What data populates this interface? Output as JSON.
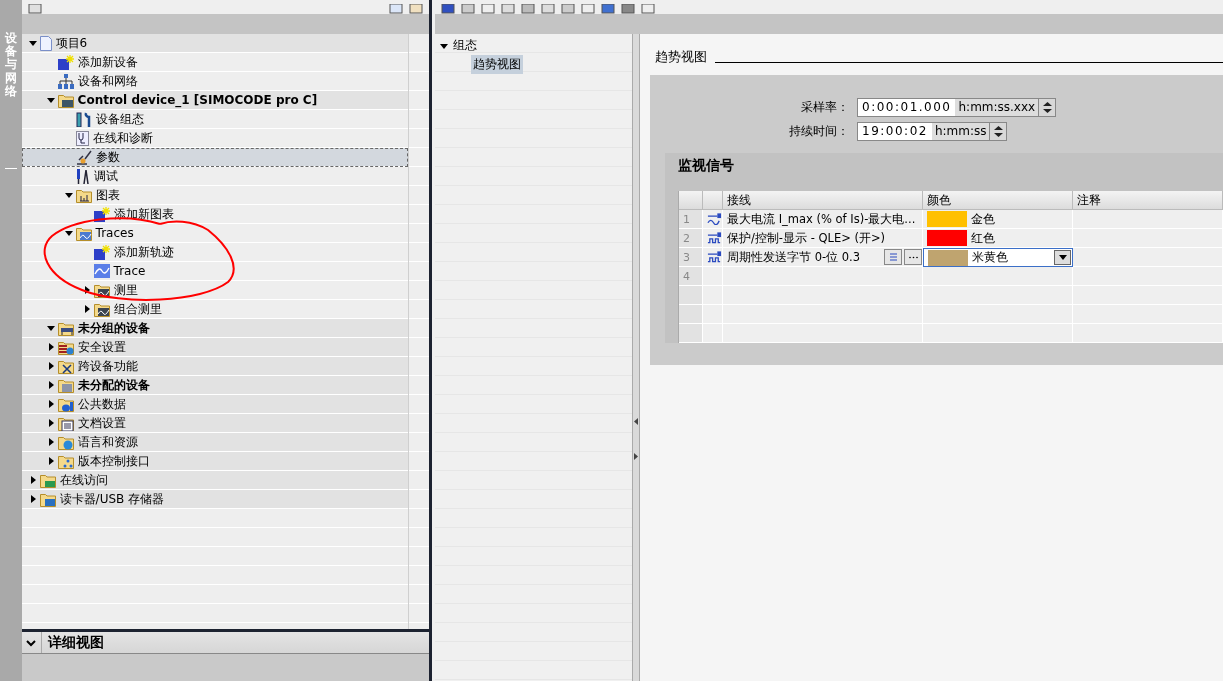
{
  "side_tab": {
    "label": "设备与网络"
  },
  "project_tree": {
    "items": [
      {
        "label": "项目6",
        "kind": "project",
        "expanded": true,
        "selected": false,
        "children": [
          {
            "label": "添加新设备",
            "kind": "add",
            "selected": false
          },
          {
            "label": "设备和网络",
            "kind": "network",
            "selected": false
          },
          {
            "label": "Control device_1 [SIMOCODE pro C]",
            "kind": "device",
            "bold": true,
            "expanded": true,
            "selected": false,
            "children": [
              {
                "label": "设备组态",
                "kind": "config",
                "selected": false
              },
              {
                "label": "在线和诊断",
                "kind": "diagnostics",
                "selected": false
              },
              {
                "label": "参数",
                "kind": "parameters",
                "selected": true
              },
              {
                "label": "调试",
                "kind": "tools",
                "selected": false
              },
              {
                "label": "图表",
                "kind": "chartfolder",
                "expanded": true,
                "selected": false,
                "children": [
                  {
                    "label": "添加新图表",
                    "kind": "add",
                    "selected": false
                  }
                ]
              },
              {
                "label": "Traces",
                "kind": "tracefolder",
                "expanded": true,
                "selected": false,
                "children": [
                  {
                    "label": "添加新轨迹",
                    "kind": "add",
                    "selected": false
                  },
                  {
                    "label": "Trace",
                    "kind": "trace",
                    "selected": false
                  },
                  {
                    "label": "测里",
                    "kind": "measurefolder",
                    "expanded": false,
                    "selected": false
                  },
                  {
                    "label": "组合测里",
                    "kind": "measurefolder",
                    "expanded": false,
                    "selected": false
                  }
                ]
              }
            ]
          },
          {
            "label": "未分组的设备",
            "kind": "groupfolder",
            "bold": true,
            "expanded": true,
            "selected": false
          },
          {
            "label": "安全设置",
            "kind": "securityfolder",
            "expanded": false,
            "selected": false
          },
          {
            "label": "跨设备功能",
            "kind": "crossfolder",
            "expanded": false,
            "selected": false
          },
          {
            "label": "未分配的设备",
            "kind": "unknownfolder",
            "bold": true,
            "expanded": false,
            "selected": false
          },
          {
            "label": "公共数据",
            "kind": "datafolder",
            "expanded": false,
            "selected": false
          },
          {
            "label": "文档设置",
            "kind": "docfolder",
            "expanded": false,
            "selected": false
          },
          {
            "label": "语言和资源",
            "kind": "globefolder",
            "expanded": false,
            "selected": false
          },
          {
            "label": "版本控制接口",
            "kind": "versionfolder",
            "expanded": false,
            "selected": false
          }
        ]
      },
      {
        "label": "在线访问",
        "kind": "onlinefolder",
        "expanded": false,
        "selected": false
      },
      {
        "label": "读卡器/USB 存储器",
        "kind": "cardfolder",
        "expanded": false,
        "selected": false
      }
    ]
  },
  "details_view": {
    "title": "详细视图",
    "expanded": true
  },
  "nav_tree": {
    "items": [
      {
        "label": "组态",
        "expanded": true,
        "selected": false,
        "children": [
          {
            "label": "趋势视图",
            "selected": true
          }
        ]
      }
    ]
  },
  "editor": {
    "title": "趋势视图",
    "fields": [
      {
        "label": "采样率：",
        "value": "0:00:01.000",
        "unit": "h:mm:ss.xxx"
      },
      {
        "label": "持续时间：",
        "value": "19:00:02",
        "unit": "h:mm:ss"
      }
    ],
    "signals": {
      "title": "监视信号",
      "columns": [
        "接线",
        "颜色",
        "注释"
      ],
      "rows": [
        {
          "kind": "analog",
          "index": "1",
          "name": "最大电流 I_max (% of Is)-最大电...",
          "color": "#ffc000",
          "color_name": "金色",
          "selected": false
        },
        {
          "kind": "digital",
          "index": "2",
          "name": "保护/控制-显示 - QLE> (开>)",
          "color": "#ff0000",
          "color_name": "红色",
          "selected": false
        },
        {
          "kind": "digital",
          "index": "3",
          "name": "周期性发送字节 0-位 0.3",
          "color": "#bfa46f",
          "color_name": "米黄色",
          "selected": true
        },
        {
          "kind": "new",
          "index": "4"
        }
      ]
    }
  }
}
